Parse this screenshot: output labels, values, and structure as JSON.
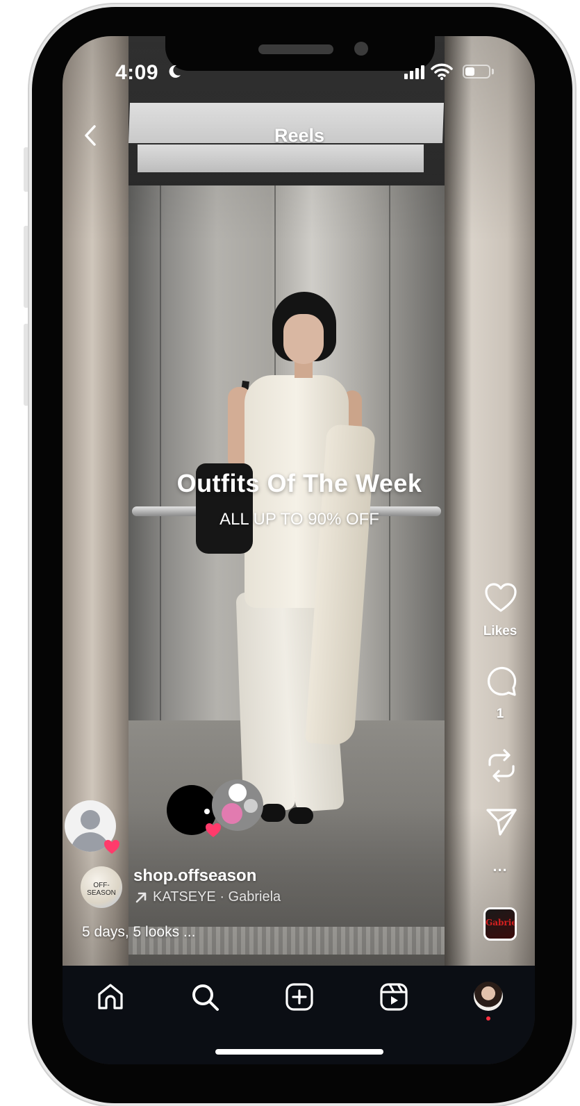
{
  "status_bar": {
    "time": "4:09",
    "battery_level": 0.4
  },
  "header": {
    "title": "Reels",
    "back_icon": "chevron-left-icon"
  },
  "reel": {
    "headline": "Outfits Of The Week",
    "subline": "ALL UP TO 90% OFF",
    "author": {
      "username": "shop.offseason",
      "avatar_text": "OFF-SEASON"
    },
    "audio": {
      "icon": "arrow-up-right-icon",
      "label": "KATSEYE · Gabriela"
    },
    "caption": "5 days, 5 looks ..."
  },
  "actions": {
    "like": {
      "icon": "heart-icon",
      "label": "Likes"
    },
    "comment": {
      "icon": "comment-icon",
      "count": "1"
    },
    "remix": {
      "icon": "repost-icon"
    },
    "share": {
      "icon": "send-icon"
    },
    "more": {
      "icon": "more-icon",
      "label": "..."
    },
    "audio_tile": {
      "text": "Gabriela"
    }
  },
  "bottom_nav": {
    "items": [
      {
        "icon": "home-icon"
      },
      {
        "icon": "search-icon"
      },
      {
        "icon": "create-icon"
      },
      {
        "icon": "reels-icon"
      },
      {
        "icon": "profile-avatar"
      }
    ]
  },
  "colors": {
    "notification_dot": "#ff3040",
    "like_badge": "#ff3b6b",
    "nav_background": "#0b0e14"
  }
}
